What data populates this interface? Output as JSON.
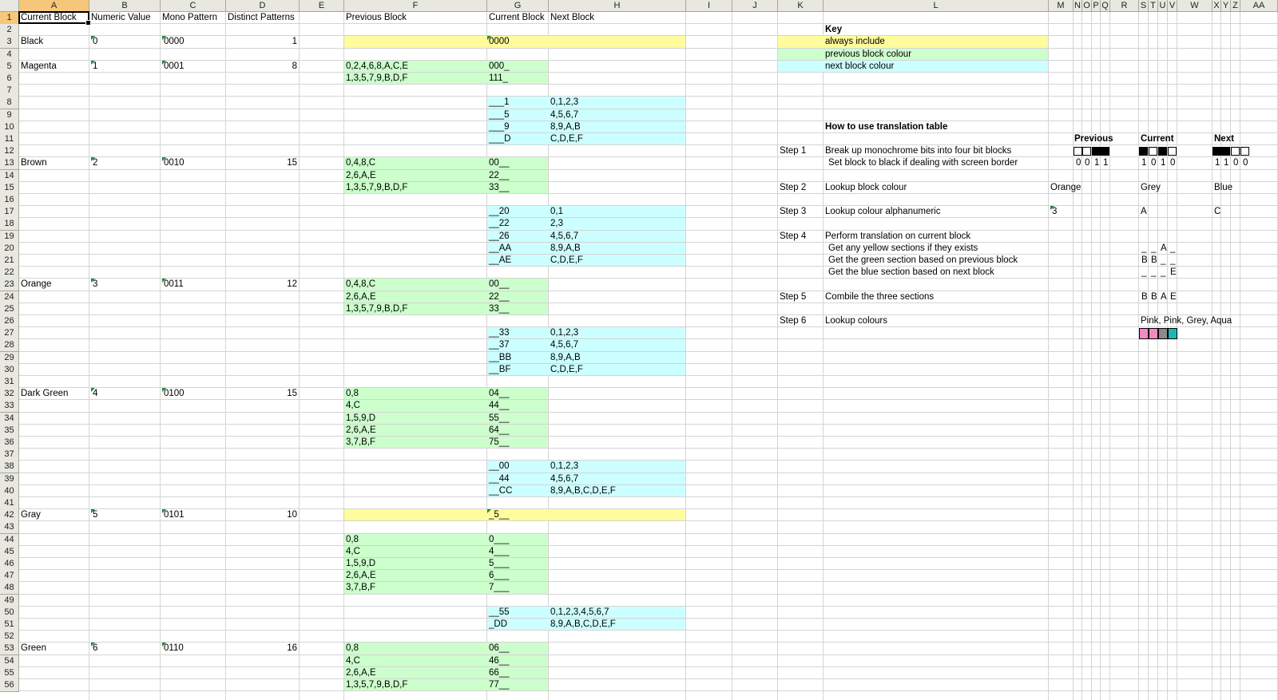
{
  "column_headers": [
    "A",
    "B",
    "C",
    "D",
    "E",
    "F",
    "G",
    "H",
    "I",
    "J",
    "K",
    "L",
    "M",
    "N",
    "O",
    "P",
    "Q",
    "R",
    "S",
    "T",
    "U",
    "V",
    "W",
    "X",
    "Y",
    "Z",
    "AA"
  ],
  "selected_column": "A",
  "selected_row": 1,
  "fill_colors": {
    "yellow": "#fefc9c",
    "green": "#ccffcc",
    "blue": "#ccffff"
  },
  "header_row": {
    "current_block": "Current Block",
    "numeric_value": "Numeric Value",
    "mono_pattern": "Mono Pattern",
    "distinct_patterns": "Distinct Patterns",
    "previous_block": "Previous Block",
    "current_block_g": "Current Block",
    "next_block": "Next Block"
  },
  "color_rows": [
    {
      "row": 3,
      "name": "Black",
      "numeric": "0",
      "mono": "0000",
      "distinct": "1"
    },
    {
      "row": 5,
      "name": "Magenta",
      "numeric": "1",
      "mono": "0001",
      "distinct": "8"
    },
    {
      "row": 13,
      "name": "Brown",
      "numeric": "2",
      "mono": "0010",
      "distinct": "15"
    },
    {
      "row": 23,
      "name": "Orange",
      "numeric": "3",
      "mono": "0011",
      "distinct": "12"
    },
    {
      "row": 32,
      "name": "Dark Green",
      "numeric": "4",
      "mono": "0100",
      "distinct": "15"
    },
    {
      "row": 42,
      "name": "Gray",
      "numeric": "5",
      "mono": "0101",
      "distinct": "10"
    },
    {
      "row": 53,
      "name": "Green",
      "numeric": "6",
      "mono": "0110",
      "distinct": "16"
    }
  ],
  "translation_rows": [
    {
      "row": 3,
      "prev": "",
      "cur": "0000",
      "next": "",
      "fill": "yellow"
    },
    {
      "row": 5,
      "prev": "0,2,4,6,8,A,C,E",
      "cur": "000_",
      "next": "",
      "fill": "green"
    },
    {
      "row": 6,
      "prev": "1,3,5,7,9,B,D,F",
      "cur": "111_",
      "next": "",
      "fill": "green"
    },
    {
      "row": 8,
      "prev": "",
      "cur": "___1",
      "next": "0,1,2,3",
      "fill": "blue"
    },
    {
      "row": 9,
      "prev": "",
      "cur": "___5",
      "next": "4,5,6,7",
      "fill": "blue"
    },
    {
      "row": 10,
      "prev": "",
      "cur": "___9",
      "next": "8,9,A,B",
      "fill": "blue"
    },
    {
      "row": 11,
      "prev": "",
      "cur": "___D",
      "next": "C,D,E,F",
      "fill": "blue"
    },
    {
      "row": 13,
      "prev": "0,4,8,C",
      "cur": "00__",
      "next": "",
      "fill": "green"
    },
    {
      "row": 14,
      "prev": "2,6,A,E",
      "cur": "22__",
      "next": "",
      "fill": "green"
    },
    {
      "row": 15,
      "prev": "1,3,5,7,9,B,D,F",
      "cur": "33__",
      "next": "",
      "fill": "green"
    },
    {
      "row": 17,
      "prev": "",
      "cur": "__20",
      "next": "0,1",
      "fill": "blue"
    },
    {
      "row": 18,
      "prev": "",
      "cur": "__22",
      "next": "2,3",
      "fill": "blue"
    },
    {
      "row": 19,
      "prev": "",
      "cur": "__26",
      "next": "4,5,6,7",
      "fill": "blue"
    },
    {
      "row": 20,
      "prev": "",
      "cur": "__AA",
      "next": "8,9,A,B",
      "fill": "blue"
    },
    {
      "row": 21,
      "prev": "",
      "cur": "__AE",
      "next": "C,D,E,F",
      "fill": "blue"
    },
    {
      "row": 23,
      "prev": "0,4,8,C",
      "cur": "00__",
      "next": "",
      "fill": "green"
    },
    {
      "row": 24,
      "prev": "2,6,A,E",
      "cur": "22__",
      "next": "",
      "fill": "green"
    },
    {
      "row": 25,
      "prev": "1,3,5,7,9,B,D,F",
      "cur": "33__",
      "next": "",
      "fill": "green"
    },
    {
      "row": 27,
      "prev": "",
      "cur": "__33",
      "next": "0,1,2,3",
      "fill": "blue"
    },
    {
      "row": 28,
      "prev": "",
      "cur": "__37",
      "next": "4,5,6,7",
      "fill": "blue"
    },
    {
      "row": 29,
      "prev": "",
      "cur": "__BB",
      "next": "8,9,A,B",
      "fill": "blue"
    },
    {
      "row": 30,
      "prev": "",
      "cur": "__BF",
      "next": "C,D,E,F",
      "fill": "blue"
    },
    {
      "row": 32,
      "prev": "0,8",
      "cur": "04__",
      "next": "",
      "fill": "green"
    },
    {
      "row": 33,
      "prev": "4,C",
      "cur": "44__",
      "next": "",
      "fill": "green"
    },
    {
      "row": 34,
      "prev": "1,5,9,D",
      "cur": "55__",
      "next": "",
      "fill": "green"
    },
    {
      "row": 35,
      "prev": "2,6,A,E",
      "cur": "64__",
      "next": "",
      "fill": "green"
    },
    {
      "row": 36,
      "prev": "3,7,B,F",
      "cur": "75__",
      "next": "",
      "fill": "green"
    },
    {
      "row": 38,
      "prev": "",
      "cur": "__00",
      "next": "0,1,2,3",
      "fill": "blue"
    },
    {
      "row": 39,
      "prev": "",
      "cur": "__44",
      "next": "4,5,6,7",
      "fill": "blue"
    },
    {
      "row": 40,
      "prev": "",
      "cur": "__CC",
      "next": "8,9,A,B,C,D,E,F",
      "fill": "blue"
    },
    {
      "row": 42,
      "prev": "",
      "cur": "_5__",
      "next": "",
      "fill": "yellow"
    },
    {
      "row": 44,
      "prev": "0,8",
      "cur": "0___",
      "next": "",
      "fill": "green"
    },
    {
      "row": 45,
      "prev": "4,C",
      "cur": "4___",
      "next": "",
      "fill": "green"
    },
    {
      "row": 46,
      "prev": "1,5,9,D",
      "cur": "5___",
      "next": "",
      "fill": "green"
    },
    {
      "row": 47,
      "prev": "2,6,A,E",
      "cur": "6___",
      "next": "",
      "fill": "green"
    },
    {
      "row": 48,
      "prev": "3,7,B,F",
      "cur": "7___",
      "next": "",
      "fill": "green"
    },
    {
      "row": 50,
      "prev": "",
      "cur": "__55",
      "next": "0,1,2,3,4,5,6,7",
      "fill": "blue"
    },
    {
      "row": 51,
      "prev": "",
      "cur": "_DD",
      "next": "8,9,A,B,C,D,E,F",
      "fill": "blue"
    },
    {
      "row": 53,
      "prev": "0,8",
      "cur": "06__",
      "next": "",
      "fill": "green"
    },
    {
      "row": 54,
      "prev": "4,C",
      "cur": "46__",
      "next": "",
      "fill": "green"
    },
    {
      "row": 55,
      "prev": "2,6,A,E",
      "cur": "66__",
      "next": "",
      "fill": "green"
    },
    {
      "row": 56,
      "prev": "1,3,5,7,9,B,D,F",
      "cur": "77__",
      "next": "",
      "fill": "green"
    }
  ],
  "key": {
    "title": "Key",
    "items": [
      {
        "row": 3,
        "label": "always include",
        "fill": "yellow"
      },
      {
        "row": 4,
        "label": "previous block colour",
        "fill": "green"
      },
      {
        "row": 5,
        "label": "next block colour",
        "fill": "blue"
      }
    ]
  },
  "howto": {
    "title": "How to use translation table",
    "headings": {
      "previous": "Previous",
      "current": "Current",
      "next": "Next"
    },
    "steps": [
      {
        "row": 12,
        "step": "Step 1",
        "text": "Break up monochrome bits into four bit blocks"
      },
      {
        "row": 13,
        "step": "",
        "text": "Set block to black if dealing with screen border"
      },
      {
        "row": 15,
        "step": "Step 2",
        "text": "Lookup block colour"
      },
      {
        "row": 17,
        "step": "Step 3",
        "text": "Lookup colour alphanumeric"
      },
      {
        "row": 19,
        "step": "Step 4",
        "text": "Perform translation on current block"
      },
      {
        "row": 20,
        "step": "",
        "text": "Get any yellow sections if they exists"
      },
      {
        "row": 21,
        "step": "",
        "text": "Get the green section based on previous block"
      },
      {
        "row": 22,
        "step": "",
        "text": "Get the blue section based on next block"
      },
      {
        "row": 24,
        "step": "Step 5",
        "text": "Combile the three sections"
      },
      {
        "row": 26,
        "step": "Step 6",
        "text": "Lookup colours"
      }
    ],
    "bits": {
      "previous": [
        "0",
        "0",
        "1",
        "1"
      ],
      "current": [
        "1",
        "0",
        "1",
        "0"
      ],
      "next": [
        "1",
        "1",
        "0",
        "0"
      ]
    },
    "step2_values": {
      "previous": "Orange",
      "current": "Grey",
      "next": "Blue"
    },
    "step3_values": {
      "previous": "3",
      "current": "A",
      "next": "C"
    },
    "step4_rows": [
      {
        "row": 20,
        "cells": [
          "_",
          "_",
          "A",
          "_"
        ]
      },
      {
        "row": 21,
        "cells": [
          "B",
          "B",
          "_",
          "_"
        ]
      },
      {
        "row": 22,
        "cells": [
          "_",
          "_",
          "_",
          "E"
        ]
      }
    ],
    "step5_cells": [
      "B",
      "B",
      "A",
      "E"
    ],
    "step6_text": "Pink, Pink, Grey, Aqua",
    "step6_swatches": [
      "#f08cc0",
      "#f08cc0",
      "#8a8a8a",
      "#20b6b6"
    ]
  }
}
